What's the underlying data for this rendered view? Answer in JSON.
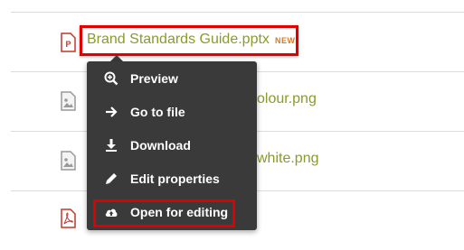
{
  "files": {
    "highlighted": {
      "name": "Brand Standards Guide.pptx",
      "badge": "NEW",
      "icon": "powerpoint-file-icon"
    },
    "rows": [
      {
        "visible_name": "olour.png",
        "icon": "image-file-icon"
      },
      {
        "visible_name": "white.png",
        "icon": "image-file-icon"
      },
      {
        "visible_name": "",
        "icon": "pdf-file-icon"
      }
    ]
  },
  "context_menu": {
    "items": [
      {
        "label": "Preview",
        "icon": "zoom-in-icon"
      },
      {
        "label": "Go to file",
        "icon": "arrow-right-icon"
      },
      {
        "label": "Download",
        "icon": "download-icon"
      },
      {
        "label": "Edit properties",
        "icon": "pencil-icon"
      },
      {
        "label": "Open for editing",
        "icon": "cloud-upload-icon"
      }
    ],
    "highlighted_index": 4
  },
  "colors": {
    "file_link": "#8a9a2e",
    "badge": "#d57a2b",
    "menu_bg": "#3a3a3a",
    "highlight_box": "#e00000",
    "icon_red": "#c0392b",
    "icon_gray": "#9a9a9a"
  }
}
